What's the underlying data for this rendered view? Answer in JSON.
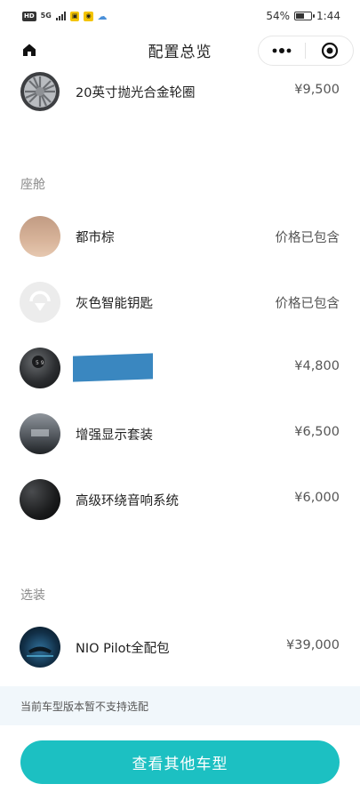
{
  "status_bar": {
    "left_chips": [
      "HD",
      "5G"
    ],
    "battery": "54%",
    "battery_level": 0.54,
    "time": "1:44"
  },
  "nav": {
    "title": "配置总览",
    "home_icon": "home-icon",
    "more_icon": "more-dots-icon",
    "close_icon": "target-close-icon"
  },
  "top_item": {
    "label": "20英寸抛光合金轮圈",
    "price": "¥9,500",
    "icon": "wheel-icon"
  },
  "cabin": {
    "title": "座舱",
    "items": [
      {
        "label": "都市棕",
        "price": "价格已包含",
        "icon": "color-swatch-icon"
      },
      {
        "label": "灰色智能钥匙",
        "price": "价格已包含",
        "icon": "nio-key-icon"
      },
      {
        "label": "",
        "price": "¥4,800",
        "icon": "steering-controls-icon",
        "redacted": true
      },
      {
        "label": "增强显示套装",
        "price": "¥6,500",
        "icon": "hud-display-icon"
      },
      {
        "label": "高级环绕音响系统",
        "price": "¥6,000",
        "icon": "speaker-icon"
      }
    ]
  },
  "optional": {
    "title": "选装",
    "items": [
      {
        "label": "NIO Pilot全配包",
        "price": "¥39,000",
        "icon": "nio-pilot-icon"
      }
    ]
  },
  "notice": "当前车型版本暂不支持选配",
  "cta_label": "查看其他车型",
  "colors": {
    "accent": "#1cc0c2",
    "notice_bg": "#f1f7fb",
    "redaction": "#3a87c0"
  }
}
